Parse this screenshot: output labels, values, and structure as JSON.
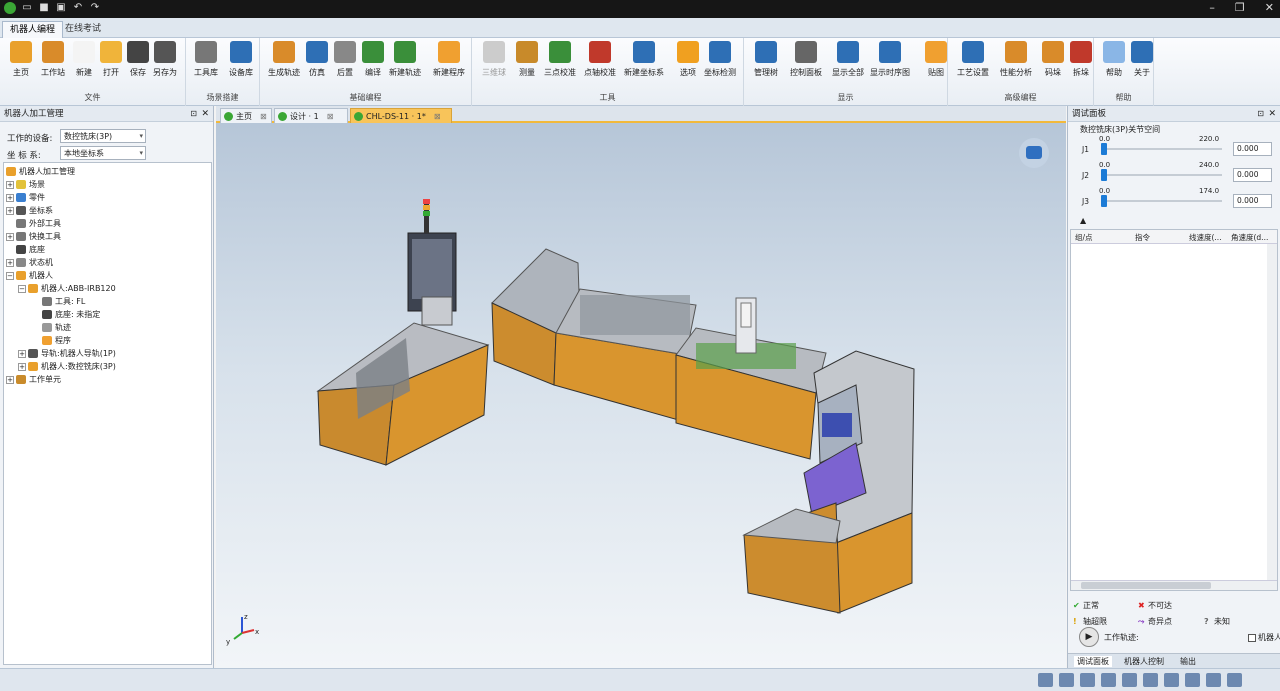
{
  "ribbon_tabs": [
    "机器人编程",
    "在线考试"
  ],
  "groups": [
    {
      "label": "文件",
      "buttons": [
        "主页",
        "工作站",
        "新建",
        "打开",
        "保存",
        "另存为"
      ]
    },
    {
      "label": "场景搭建",
      "buttons": [
        "工具库",
        "设备库"
      ]
    },
    {
      "label": "基础编程",
      "buttons": [
        "生成轨迹",
        "仿真",
        "后置",
        "编译",
        "新建轨迹",
        "新建程序"
      ]
    },
    {
      "label": "工具",
      "buttons": [
        "三维球",
        "测量",
        "三点校准",
        "点轴校准",
        "新建坐标系",
        "选项",
        "坐标检测"
      ]
    },
    {
      "label": "显示",
      "buttons": [
        "管理树",
        "控制面板",
        "显示全部",
        "显示时序图",
        "贴图"
      ]
    },
    {
      "label": "高级编程",
      "buttons": [
        "工艺设置",
        "性能分析",
        "码垛",
        "拆垛"
      ]
    },
    {
      "label": "帮助",
      "buttons": [
        "帮助",
        "关于"
      ]
    }
  ],
  "left_panel": {
    "title": "机器人加工管理",
    "device_label": "工作的设备:",
    "device_value": "数控铣床(3P)",
    "coord_label": "坐  标  系:",
    "coord_value": "本地坐标系"
  },
  "tree": {
    "root": "机器人加工管理",
    "items": [
      "场景",
      "零件",
      "坐标系",
      "外部工具",
      "快换工具",
      "底座",
      "状态机",
      "机器人"
    ],
    "robot": "机器人:ABB-IRB120",
    "robot_children": [
      "工具: FL",
      "底座: 未指定",
      "轨迹",
      "程序"
    ],
    "rail": "导轨:机器人导轨(1P)",
    "cnc": "机器人:数控铣床(3P)",
    "unit": "工作单元"
  },
  "doc_tabs": [
    "主页",
    "设计 · 1",
    "CHL-DS-11 · 1*"
  ],
  "right_panel": {
    "title": "调试面板",
    "joint_title": "数控铣床(3P)关节空间",
    "joints": [
      {
        "name": "J1",
        "min": "0.0",
        "max": "220.0",
        "value": "0.000",
        "level": 0.0
      },
      {
        "name": "J2",
        "min": "0.0",
        "max": "240.0",
        "value": "0.000",
        "level": 0.0
      },
      {
        "name": "J3",
        "min": "0.0",
        "max": "174.0",
        "value": "0.000",
        "level": 0.0
      }
    ],
    "table_headers": [
      "组/点",
      "指令",
      "线速度(...",
      "角速度(d..."
    ],
    "legend": {
      "normal": "正常",
      "unreachable": "不可达",
      "axis_limit": "轴超限",
      "singular": "奇异点",
      "unknown": "未知",
      "traj": "工作轨迹:",
      "robot_cb": "机器人"
    },
    "tabs": [
      "调试面板",
      "机器人控制",
      "输出"
    ]
  },
  "axis": {
    "x": "x",
    "y": "y",
    "z": "z"
  }
}
